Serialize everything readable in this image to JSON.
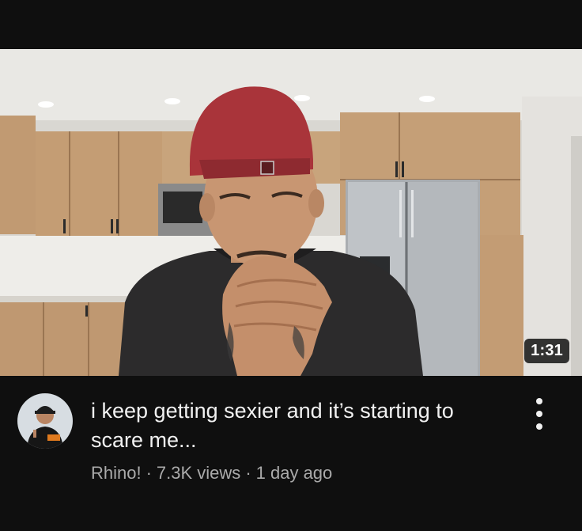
{
  "video": {
    "duration": "1:31",
    "title": "i keep getting sexier and it’s starting to scare me...",
    "channel": "Rhino!",
    "views": "7.3K views",
    "age": "1 day ago",
    "separator": "·"
  },
  "icons": {
    "more": "vertical-ellipsis-icon"
  },
  "colors": {
    "background": "#0f0f0f",
    "title_text": "#f1f1f1",
    "secondary_text": "#aaaaaa",
    "duration_badge": "#000000"
  }
}
